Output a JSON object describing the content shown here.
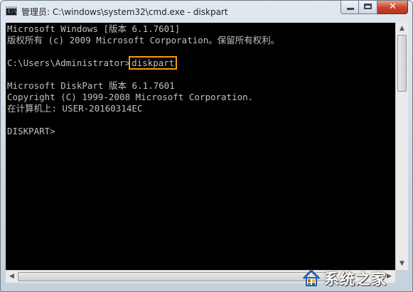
{
  "window": {
    "title": "管理员: C:\\windows\\system32\\cmd.exe - diskpart",
    "icon_label": "C:\\",
    "close_glyph": "✕"
  },
  "console": {
    "lines": [
      "Microsoft Windows [版本 6.1.7601]",
      "版权所有 (c) 2009 Microsoft Corporation。保留所有权利。",
      "",
      "C:\\Users\\Administrator>",
      "",
      "Microsoft DiskPart 版本 6.1.7601",
      "Copyright (C) 1999-2008 Microsoft Corporation.",
      "在计算机上: USER-20160314EC",
      "",
      "DISKPART>"
    ],
    "typed_command": "diskpart",
    "highlight_color": "#f39a1e"
  },
  "scrollbars": {
    "up": "▲",
    "down": "▼",
    "left": "◀",
    "right": "▶"
  },
  "watermark": {
    "text": "系统之家"
  }
}
